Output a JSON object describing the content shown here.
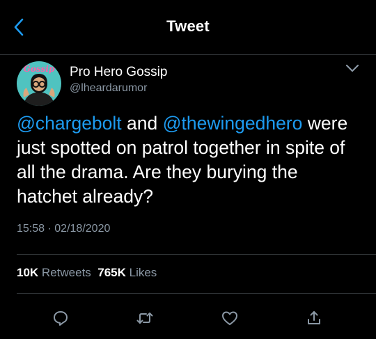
{
  "header": {
    "title": "Tweet",
    "back_icon": "chevron-left-icon"
  },
  "tweet": {
    "author": {
      "display_name": "Pro Hero Gossip",
      "handle": "@lheardarumor",
      "avatar_text": "Gossip"
    },
    "text": {
      "mention1": "@chargebolt",
      "conj": " and ",
      "mention2": "@thewingedhero",
      "body": " were just spotted on patrol together in spite of all the drama. Are they burying the hatchet already?"
    },
    "time": "15:58",
    "separator": "·",
    "date": "02/18/2020",
    "retweets_count": "10K",
    "retweets_label": "Retweets",
    "likes_count": "765K",
    "likes_label": "Likes"
  },
  "actions": [
    {
      "name": "reply",
      "icon": "reply-icon"
    },
    {
      "name": "retweet",
      "icon": "retweet-icon"
    },
    {
      "name": "like",
      "icon": "heart-icon"
    },
    {
      "name": "share",
      "icon": "share-icon"
    }
  ],
  "colors": {
    "background": "#000000",
    "accent": "#1d9bf0",
    "secondary_text": "#8b98a5",
    "divider": "#2f3336"
  }
}
